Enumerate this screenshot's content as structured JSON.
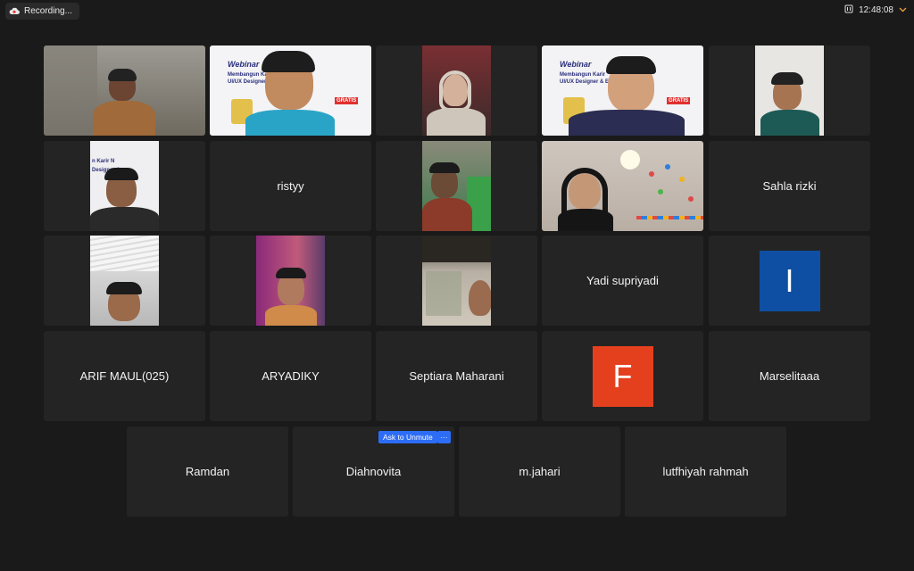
{
  "topbar": {
    "recording_label": "Recording...",
    "time": "12:48:08"
  },
  "colors": {
    "active_speaker": "#4cc24a",
    "avatar_i": "#0e4fa3",
    "avatar_f": "#e5401e",
    "ask_button": "#2d6df6"
  },
  "video_tiles": {
    "t2_poster": {
      "title": "Webinar",
      "line1": "Membangun Karir",
      "line2": "UI/UX Designer &",
      "badge": "GRATIS"
    },
    "t4_poster": {
      "title": "Webinar",
      "line1": "Membangun Karir",
      "line2": "UI/UX Designer & E",
      "badge": "GRATIS"
    },
    "t6_poster": {
      "line1": "n Karir N",
      "line2": "Designer &"
    }
  },
  "names": {
    "ristyy": "ristyy",
    "sahla": "Sahla rizki",
    "yadi": "Yadi supriyadi",
    "arif": "ARIF MAUL(025)",
    "aryadiky": "ARYADIKY",
    "septiara": "Septiara Maharani",
    "marselitaaa": "Marselitaaa",
    "ramdan": "Ramdan",
    "diahnovita": "Diahnovita",
    "mjahari": "m.jahari",
    "lutfhiyah": "lutfhiyah rahmah"
  },
  "avatars": {
    "i_letter": "I",
    "f_letter": "F"
  },
  "controls": {
    "ask_to_unmute": "Ask to Unmute",
    "more": "···"
  }
}
